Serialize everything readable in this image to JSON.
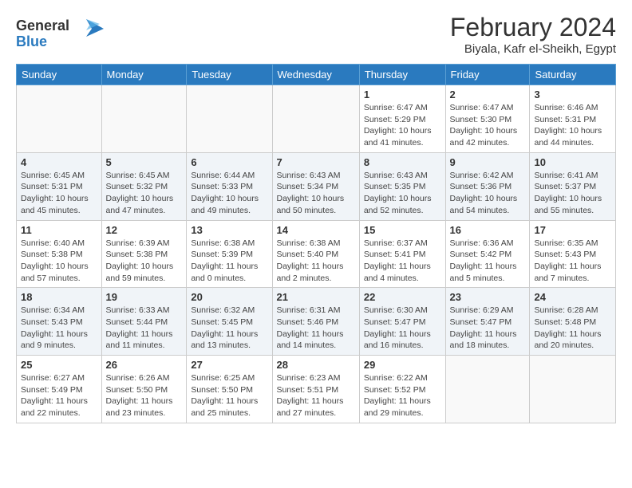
{
  "logo": {
    "line1": "General",
    "line2": "Blue"
  },
  "title": "February 2024",
  "subtitle": "Biyala, Kafr el-Sheikh, Egypt",
  "weekdays": [
    "Sunday",
    "Monday",
    "Tuesday",
    "Wednesday",
    "Thursday",
    "Friday",
    "Saturday"
  ],
  "weeks": [
    [
      {
        "day": "",
        "info": ""
      },
      {
        "day": "",
        "info": ""
      },
      {
        "day": "",
        "info": ""
      },
      {
        "day": "",
        "info": ""
      },
      {
        "day": "1",
        "info": "Sunrise: 6:47 AM\nSunset: 5:29 PM\nDaylight: 10 hours\nand 41 minutes."
      },
      {
        "day": "2",
        "info": "Sunrise: 6:47 AM\nSunset: 5:30 PM\nDaylight: 10 hours\nand 42 minutes."
      },
      {
        "day": "3",
        "info": "Sunrise: 6:46 AM\nSunset: 5:31 PM\nDaylight: 10 hours\nand 44 minutes."
      }
    ],
    [
      {
        "day": "4",
        "info": "Sunrise: 6:45 AM\nSunset: 5:31 PM\nDaylight: 10 hours\nand 45 minutes."
      },
      {
        "day": "5",
        "info": "Sunrise: 6:45 AM\nSunset: 5:32 PM\nDaylight: 10 hours\nand 47 minutes."
      },
      {
        "day": "6",
        "info": "Sunrise: 6:44 AM\nSunset: 5:33 PM\nDaylight: 10 hours\nand 49 minutes."
      },
      {
        "day": "7",
        "info": "Sunrise: 6:43 AM\nSunset: 5:34 PM\nDaylight: 10 hours\nand 50 minutes."
      },
      {
        "day": "8",
        "info": "Sunrise: 6:43 AM\nSunset: 5:35 PM\nDaylight: 10 hours\nand 52 minutes."
      },
      {
        "day": "9",
        "info": "Sunrise: 6:42 AM\nSunset: 5:36 PM\nDaylight: 10 hours\nand 54 minutes."
      },
      {
        "day": "10",
        "info": "Sunrise: 6:41 AM\nSunset: 5:37 PM\nDaylight: 10 hours\nand 55 minutes."
      }
    ],
    [
      {
        "day": "11",
        "info": "Sunrise: 6:40 AM\nSunset: 5:38 PM\nDaylight: 10 hours\nand 57 minutes."
      },
      {
        "day": "12",
        "info": "Sunrise: 6:39 AM\nSunset: 5:38 PM\nDaylight: 10 hours\nand 59 minutes."
      },
      {
        "day": "13",
        "info": "Sunrise: 6:38 AM\nSunset: 5:39 PM\nDaylight: 11 hours\nand 0 minutes."
      },
      {
        "day": "14",
        "info": "Sunrise: 6:38 AM\nSunset: 5:40 PM\nDaylight: 11 hours\nand 2 minutes."
      },
      {
        "day": "15",
        "info": "Sunrise: 6:37 AM\nSunset: 5:41 PM\nDaylight: 11 hours\nand 4 minutes."
      },
      {
        "day": "16",
        "info": "Sunrise: 6:36 AM\nSunset: 5:42 PM\nDaylight: 11 hours\nand 5 minutes."
      },
      {
        "day": "17",
        "info": "Sunrise: 6:35 AM\nSunset: 5:43 PM\nDaylight: 11 hours\nand 7 minutes."
      }
    ],
    [
      {
        "day": "18",
        "info": "Sunrise: 6:34 AM\nSunset: 5:43 PM\nDaylight: 11 hours\nand 9 minutes."
      },
      {
        "day": "19",
        "info": "Sunrise: 6:33 AM\nSunset: 5:44 PM\nDaylight: 11 hours\nand 11 minutes."
      },
      {
        "day": "20",
        "info": "Sunrise: 6:32 AM\nSunset: 5:45 PM\nDaylight: 11 hours\nand 13 minutes."
      },
      {
        "day": "21",
        "info": "Sunrise: 6:31 AM\nSunset: 5:46 PM\nDaylight: 11 hours\nand 14 minutes."
      },
      {
        "day": "22",
        "info": "Sunrise: 6:30 AM\nSunset: 5:47 PM\nDaylight: 11 hours\nand 16 minutes."
      },
      {
        "day": "23",
        "info": "Sunrise: 6:29 AM\nSunset: 5:47 PM\nDaylight: 11 hours\nand 18 minutes."
      },
      {
        "day": "24",
        "info": "Sunrise: 6:28 AM\nSunset: 5:48 PM\nDaylight: 11 hours\nand 20 minutes."
      }
    ],
    [
      {
        "day": "25",
        "info": "Sunrise: 6:27 AM\nSunset: 5:49 PM\nDaylight: 11 hours\nand 22 minutes."
      },
      {
        "day": "26",
        "info": "Sunrise: 6:26 AM\nSunset: 5:50 PM\nDaylight: 11 hours\nand 23 minutes."
      },
      {
        "day": "27",
        "info": "Sunrise: 6:25 AM\nSunset: 5:50 PM\nDaylight: 11 hours\nand 25 minutes."
      },
      {
        "day": "28",
        "info": "Sunrise: 6:23 AM\nSunset: 5:51 PM\nDaylight: 11 hours\nand 27 minutes."
      },
      {
        "day": "29",
        "info": "Sunrise: 6:22 AM\nSunset: 5:52 PM\nDaylight: 11 hours\nand 29 minutes."
      },
      {
        "day": "",
        "info": ""
      },
      {
        "day": "",
        "info": ""
      }
    ]
  ]
}
